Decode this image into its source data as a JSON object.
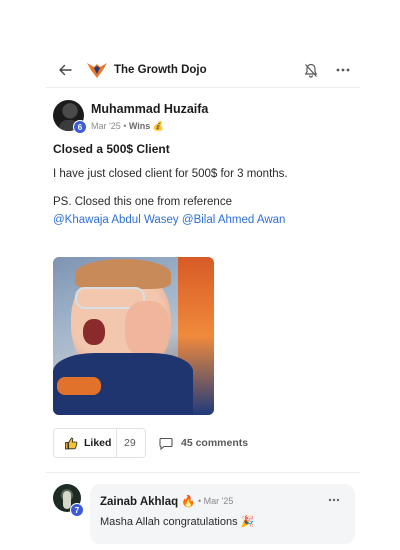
{
  "header": {
    "community_name": "The Growth Dojo",
    "icons": {
      "back": "arrow-left-icon",
      "logo": "growth-dojo-logo",
      "bell": "bell-icon",
      "more": "more-horizontal-icon"
    }
  },
  "post": {
    "author": {
      "name": "Muhammad Huzaifa",
      "level": "6",
      "meta": "Mar '25 • ",
      "category": "Wins 💰"
    },
    "title": "Closed a 500$ Client",
    "body_line1": "I have just closed client for 500$ for 3 months.",
    "body_line2": "PS. Closed this one from reference",
    "mentions": [
      "@Khawaja Abdul Wasey",
      "@Bilal Ahmed Awan"
    ],
    "actions": {
      "like_label": "Liked",
      "like_count": "29",
      "comments_label": "45 comments"
    }
  },
  "comment": {
    "author": "Zainab Akhlaq 🔥",
    "level": "7",
    "date": "• Mar '25",
    "text": "Masha Allah congratulations 🎉"
  },
  "colors": {
    "accent": "#2f6fd6",
    "badge": "#3b5bdb",
    "brand_orange": "#e8772e"
  }
}
